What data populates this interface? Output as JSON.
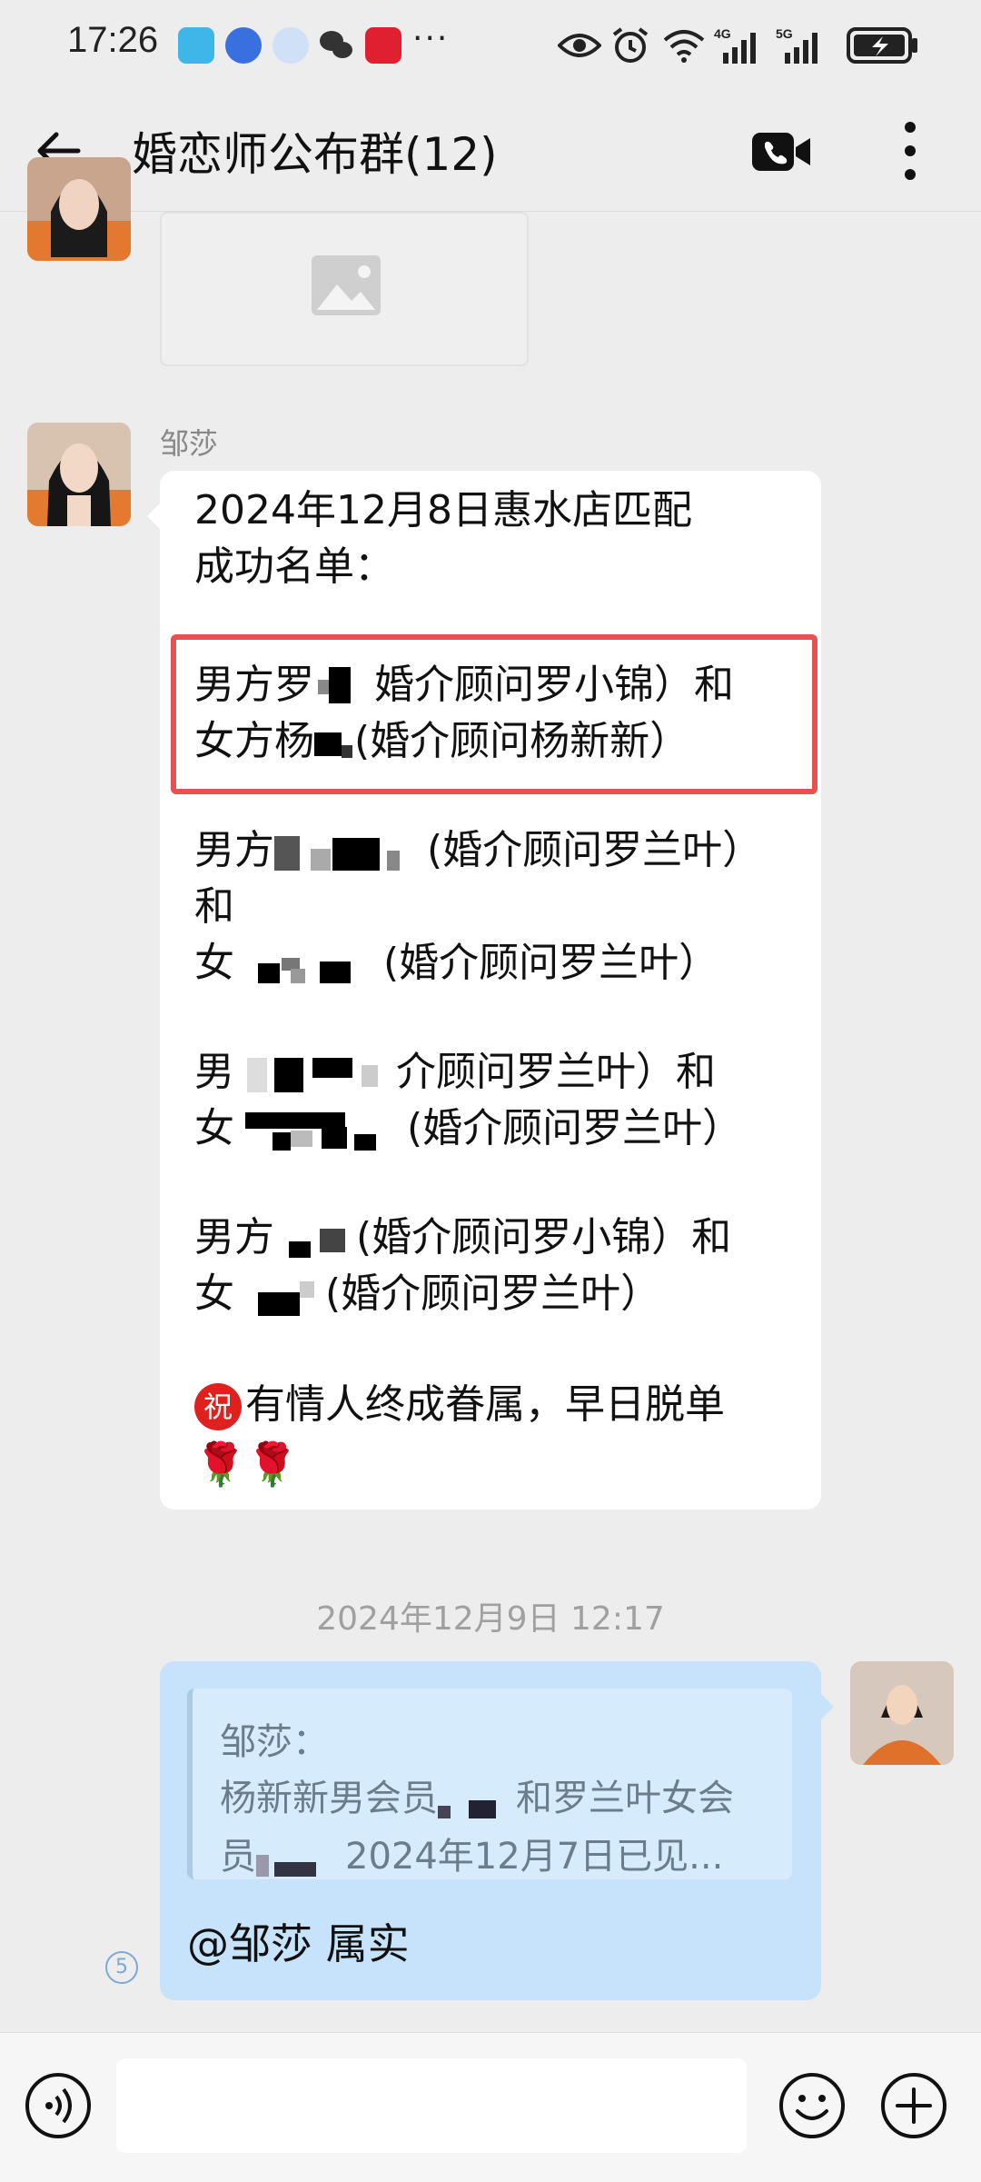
{
  "status_bar": {
    "time": "17:26",
    "battery_color": "#222222"
  },
  "title_bar": {
    "title": "婚恋师公布群(12)"
  },
  "messages": {
    "group_sender": "邹莎",
    "list": {
      "heading_1": "2024年12月8日惠水店匹配",
      "heading_2": "成功名单：",
      "p1_l1_a": "男方罗",
      "p1_l1_b": "婚介顾问罗小锦）和",
      "p1_l2_a": "女方杨",
      "p1_l2_b": "(婚介顾问杨新新）",
      "p2_l1_a": "男方",
      "p2_l1_b": "(婚介顾问罗兰叶）",
      "p2_l2": "和",
      "p2_l3_a": "女",
      "p2_l3_b": "(婚介顾问罗兰叶）",
      "p3_l1_a": "男",
      "p3_l1_b": "介顾问罗兰叶）和",
      "p3_l2_a": "女",
      "p3_l2_b": "(婚介顾问罗兰叶）",
      "p4_l1_a": "男方",
      "p4_l1_b": "(婚介顾问罗小锦）和",
      "p4_l2_a": "女",
      "p4_l2_b": "(婚介顾问罗兰叶）",
      "wish_badge": "祝",
      "wish_text": "有情人终成眷属，早日脱单",
      "emoji": "🌹🌹"
    },
    "timestamp": "2024年12月9日  12:17",
    "quote": {
      "author": "邹莎：",
      "line1_a": "杨新新男会员",
      "line1_b": "和罗兰叶女会",
      "line2_a": "员",
      "line2_b": "2024年12月7日已见..."
    },
    "reply": "@邹莎 属实",
    "read_count": "5"
  },
  "input_bar": {
    "placeholder": ""
  }
}
